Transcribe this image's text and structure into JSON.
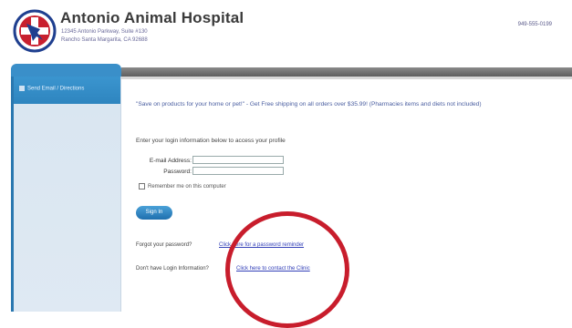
{
  "header": {
    "title": "Antonio Animal Hospital",
    "address_line1": "12345 Antonio Parkway, Suite #130",
    "address_line2": "Rancho Santa Margarita, CA 92688",
    "phone": "949-555-0199"
  },
  "sidebar": {
    "button_label": "Send Email / Directions"
  },
  "promo": "\"Save on products for your home or pet!\" - Get Free shipping on all orders over $35.99! (Pharmacies items and diets not included)",
  "login": {
    "instructions": "Enter your login information below to access your profile",
    "email_label": "E-mail Address:",
    "password_label": "Password:",
    "email_value": "",
    "password_value": "",
    "remember_label": "Remember me on this computer",
    "signin_label": "Sign In"
  },
  "help": {
    "forgot_question": "Forgot your password?",
    "forgot_link": "Click here for a password reminder",
    "nologin_question": "Don't have Login Information?",
    "contact_link": "Click here to contact the Clinic"
  },
  "colors": {
    "accent": "#2e85bf",
    "annotation": "#c81d2c",
    "link": "#3340b8"
  }
}
